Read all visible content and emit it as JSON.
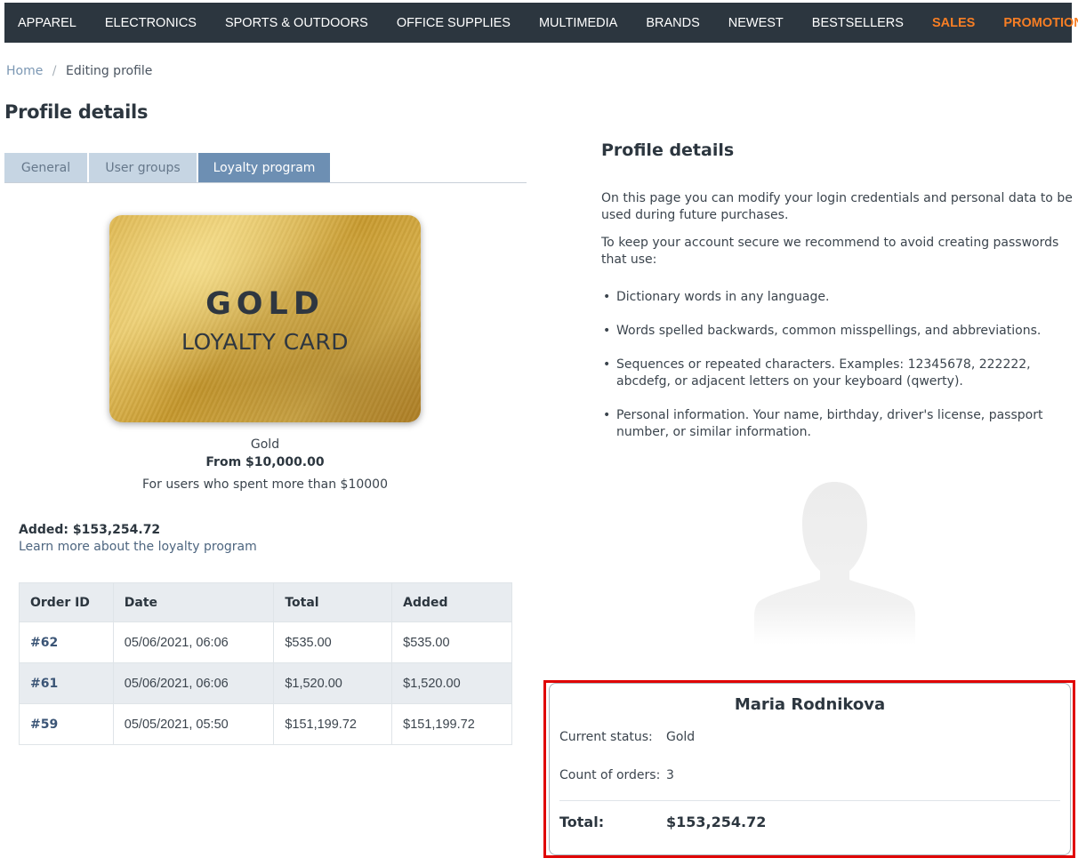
{
  "nav": {
    "items": [
      "Apparel",
      "Electronics",
      "Sports & Outdoors",
      "Office supplies",
      "Multimedia",
      "Brands",
      "Newest",
      "Bestsellers"
    ],
    "accent_items": [
      "Sales",
      "Promotions"
    ],
    "accent_color": "#f77e24"
  },
  "breadcrumb": {
    "home": "Home",
    "separator": "/",
    "current": "Editing profile"
  },
  "page_title": "Profile details",
  "tabs": [
    {
      "label": "General",
      "active": false
    },
    {
      "label": "User groups",
      "active": false
    },
    {
      "label": "Loyalty program",
      "active": true
    }
  ],
  "loyalty": {
    "card_title": "GOLD",
    "card_subtitle": "LOYALTY CARD",
    "level_name": "Gold",
    "level_from": "From $10,000.00",
    "level_desc": "For users who spent more than $10000",
    "added_total": "Added: $153,254.72",
    "learn_more": "Learn more about the loyalty program"
  },
  "orders": {
    "headers": [
      "Order ID",
      "Date",
      "Total",
      "Added"
    ],
    "rows": [
      [
        "#62",
        "05/06/2021, 06:06",
        "$535.00",
        "$535.00"
      ],
      [
        "#61",
        "05/06/2021, 06:06",
        "$1,520.00",
        "$1,520.00"
      ],
      [
        "#59",
        "05/05/2021, 05:50",
        "$151,199.72",
        "$151,199.72"
      ]
    ]
  },
  "info": {
    "title": "Profile details",
    "p1": "On this page you can modify your login credentials and personal data to be used during future purchases.",
    "p2": "To keep your account secure we recommend to avoid creating passwords that use:",
    "rules": [
      "Dictionary words in any language.",
      "Words spelled backwards, common misspellings, and abbreviations.",
      "Sequences or repeated characters. Examples: 12345678, 222222, abcdefg, or adjacent letters on your keyboard (qwerty).",
      "Personal information. Your name, birthday, driver's license, passport number, or similar information."
    ]
  },
  "summary": {
    "name": "Maria Rodnikova",
    "status_label": "Current status:",
    "status_value": "Gold",
    "count_label": "Count of orders:",
    "count_value": "3",
    "total_label": "Total:",
    "total_value": "$153,254.72",
    "highlight_color": "#e00000"
  }
}
